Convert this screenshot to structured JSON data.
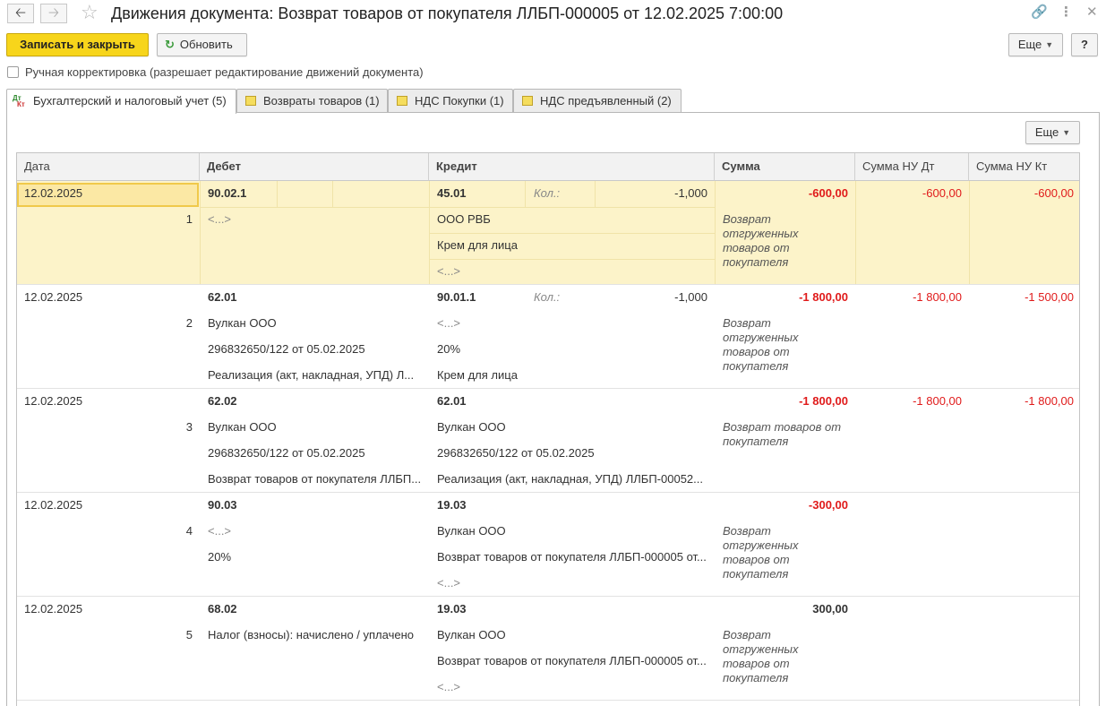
{
  "header": {
    "title": "Движения документа: Возврат товаров от покупателя ЛЛБП-000005 от 12.02.2025 7:00:00"
  },
  "toolbar": {
    "save_close": "Записать и закрыть",
    "refresh": "Обновить",
    "more": "Еще",
    "help": "?"
  },
  "manual_checkbox": {
    "label": "Ручная корректировка (разрешает редактирование движений документа)",
    "checked": false
  },
  "tabs": [
    {
      "label": "Бухгалтерский и налоговый учет (5)",
      "active": true
    },
    {
      "label": "Возвраты товаров (1)"
    },
    {
      "label": "НДС Покупки (1)"
    },
    {
      "label": "НДС предъявленный (2)"
    }
  ],
  "panel": {
    "more": "Еще"
  },
  "table": {
    "columns": [
      "Дата",
      "Дебет",
      "Кредит",
      "Сумма",
      "Сумма НУ Дт",
      "Сумма НУ Кт"
    ],
    "qty_label": "Кол.:",
    "rows": [
      {
        "date": "12.02.2025",
        "num": "1",
        "debit": [
          "90.02.1",
          "<...>",
          "",
          ""
        ],
        "credit": [
          "45.01",
          "ООО РВБ",
          "Крем для лица",
          "<...>"
        ],
        "qty": "-1,000",
        "sum": "-600,00",
        "sum_desc": "Возврат отгруженных товаров от покупателя",
        "nu_dt": "-600,00",
        "nu_kt": "-600,00"
      },
      {
        "date": "12.02.2025",
        "num": "2",
        "debit": [
          "62.01",
          "Вулкан ООО",
          "296832650/122 от 05.02.2025",
          "Реализация (акт, накладная, УПД) Л..."
        ],
        "credit": [
          "90.01.1",
          "<...>",
          "20%",
          "Крем для лица"
        ],
        "qty": "-1,000",
        "sum": "-1 800,00",
        "sum_desc": "Возврат отгруженных товаров от покупателя",
        "nu_dt": "-1 800,00",
        "nu_kt": "-1 500,00"
      },
      {
        "date": "12.02.2025",
        "num": "3",
        "debit": [
          "62.02",
          "Вулкан ООО",
          "296832650/122 от 05.02.2025",
          "Возврат товаров от покупателя ЛЛБП..."
        ],
        "credit": [
          "62.01",
          "Вулкан ООО",
          "296832650/122 от 05.02.2025",
          "Реализация (акт, накладная, УПД) ЛЛБП-00052..."
        ],
        "qty": "",
        "sum": "-1 800,00",
        "sum_desc": "Возврат товаров от покупателя",
        "nu_dt": "-1 800,00",
        "nu_kt": "-1 800,00"
      },
      {
        "date": "12.02.2025",
        "num": "4",
        "debit": [
          "90.03",
          "<...>",
          "20%",
          ""
        ],
        "credit": [
          "19.03",
          "Вулкан ООО",
          "Возврат товаров от покупателя ЛЛБП-000005 от...",
          "<...>"
        ],
        "qty": "",
        "sum": "-300,00",
        "sum_desc": "Возврат отгруженных товаров от покупателя",
        "nu_dt": "",
        "nu_kt": ""
      },
      {
        "date": "12.02.2025",
        "num": "5",
        "debit": [
          "68.02",
          "Налог (взносы): начислено / уплачено",
          "",
          ""
        ],
        "credit": [
          "19.03",
          "Вулкан ООО",
          "Возврат товаров от покупателя ЛЛБП-000005 от...",
          "<...>"
        ],
        "qty": "",
        "sum": "300,00",
        "sum_desc": "Возврат отгруженных товаров от покупателя",
        "nu_dt": "",
        "nu_kt": ""
      }
    ]
  }
}
